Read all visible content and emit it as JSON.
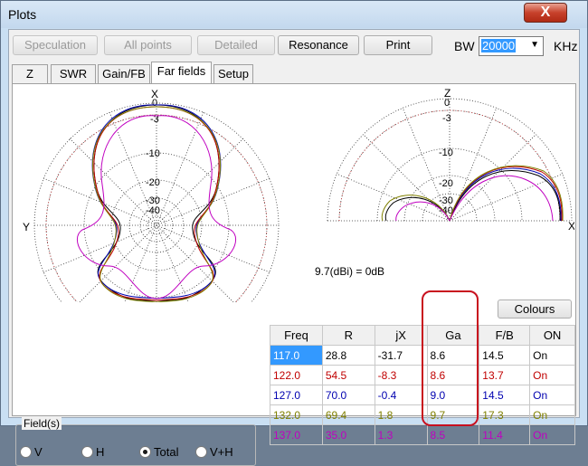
{
  "window": {
    "title": "Plots",
    "close_symbol": "X"
  },
  "toolbar": {
    "buttons": [
      "Speculation",
      "All points",
      "Detailed",
      "Resonance",
      "Print"
    ],
    "bw_label": "BW",
    "bw_value": "20000",
    "unit": "KHz"
  },
  "tabs": [
    "Z",
    "SWR",
    "Gain/FB",
    "Far fields",
    "Setup"
  ],
  "plot": {
    "azimuth_labels": [
      "0",
      "-3",
      "-10",
      "-20",
      "-30",
      "-40"
    ],
    "axis_x": "X",
    "axis_y": "Y",
    "axis_z": "Z",
    "elevation_labels": [
      "0",
      "-3",
      "-10",
      "-20",
      "-30",
      "-40"
    ],
    "scale_text": "9.7(dBi) = 0dB",
    "colours_button": "Colours"
  },
  "table": {
    "headers": [
      "Freq",
      "R",
      "jX",
      "Ga",
      "F/B",
      "ON"
    ],
    "rows": [
      {
        "freq": "117.0",
        "r": "28.8",
        "jx": "-31.7",
        "ga": "8.6",
        "fb": "14.5",
        "on": "On",
        "color": "#000000"
      },
      {
        "freq": "122.0",
        "r": "54.5",
        "jx": "-8.3",
        "ga": "8.6",
        "fb": "13.7",
        "on": "On",
        "color": "#c00000"
      },
      {
        "freq": "127.0",
        "r": "70.0",
        "jx": "-0.4",
        "ga": "9.0",
        "fb": "14.5",
        "on": "On",
        "color": "#0000b0"
      },
      {
        "freq": "132.0",
        "r": "69.4",
        "jx": "1.8",
        "ga": "9.7",
        "fb": "17.3",
        "on": "On",
        "color": "#808000"
      },
      {
        "freq": "137.0",
        "r": "35.0",
        "jx": "1.3",
        "ga": "8.5",
        "fb": "11.4",
        "on": "On",
        "color": "#c000c0"
      }
    ]
  },
  "fields": {
    "title": "Field(s)",
    "options": [
      "V",
      "H",
      "Total",
      "V+H"
    ],
    "selected": "Total"
  }
}
